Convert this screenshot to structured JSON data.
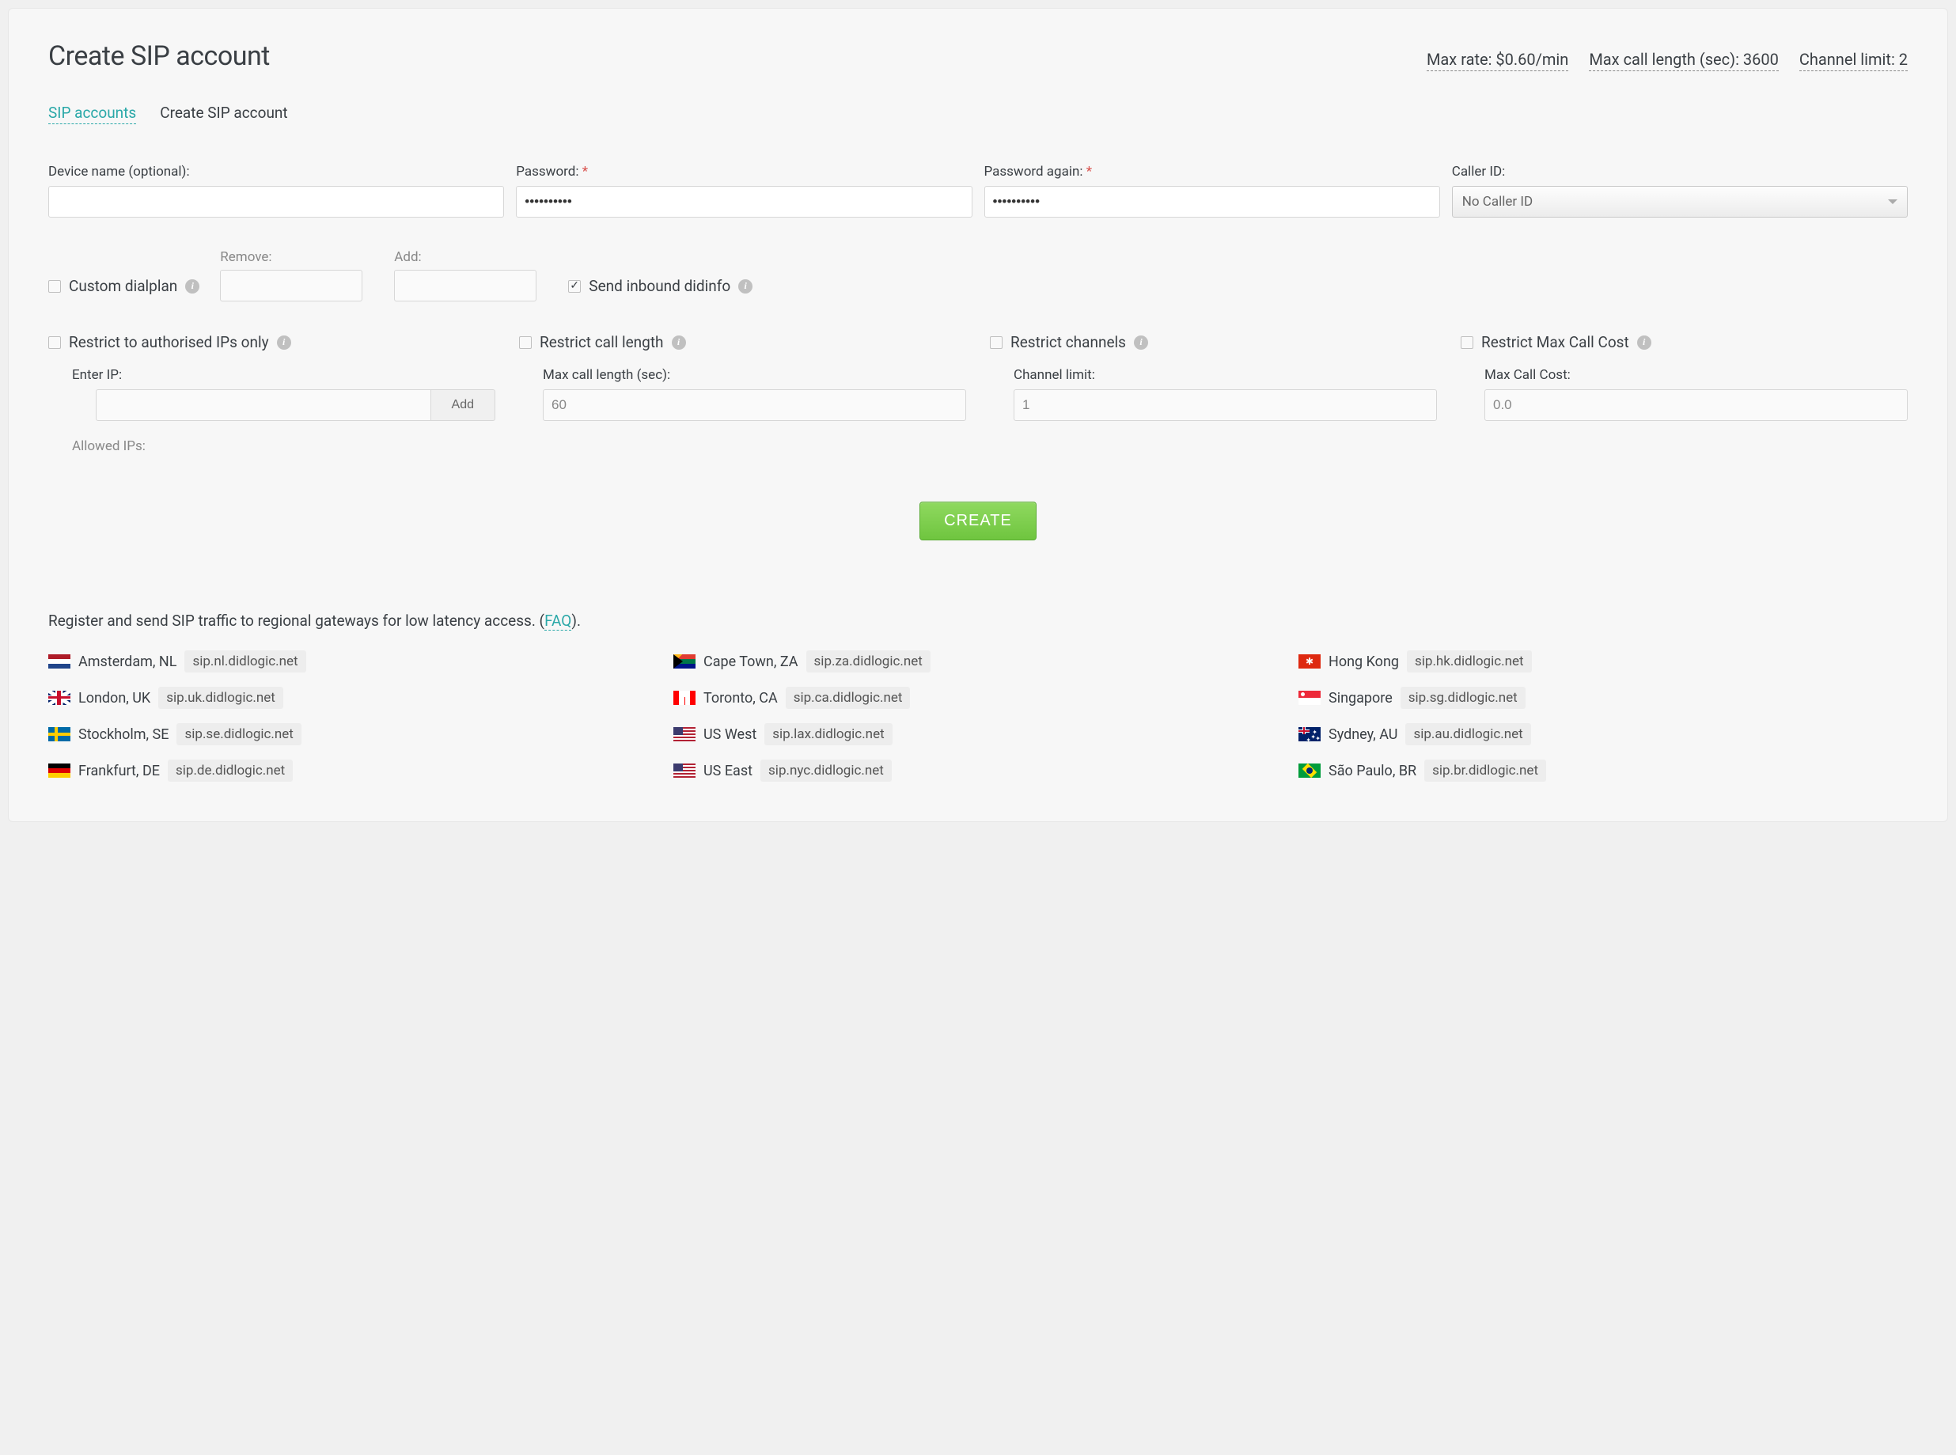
{
  "header": {
    "title": "Create SIP account",
    "max_rate": "Max rate: $0.60/min",
    "max_call_length": "Max call length (sec): 3600",
    "channel_limit": "Channel limit: 2"
  },
  "tabs": {
    "sip_accounts": "SIP accounts",
    "create": "Create SIP account"
  },
  "fields": {
    "device_name_label": "Device name (optional):",
    "password_label": "Password:",
    "password_again_label": "Password again:",
    "caller_id_label": "Caller ID:",
    "caller_id_value": "No Caller ID",
    "password_value": "••••••••••",
    "password_again_value": "••••••••••"
  },
  "dialplan": {
    "custom_label": "Custom dialplan",
    "remove_label": "Remove:",
    "add_label": "Add:",
    "didinfo_label": "Send inbound didinfo",
    "didinfo_checked": true
  },
  "restrict": {
    "ips": {
      "label": "Restrict to authorised IPs only",
      "enter_ip_label": "Enter IP:",
      "add_btn": "Add",
      "allowed_label": "Allowed IPs:"
    },
    "length": {
      "label": "Restrict call length",
      "sub": "Max call length (sec):",
      "value": "60"
    },
    "channels": {
      "label": "Restrict channels",
      "sub": "Channel limit:",
      "value": "1"
    },
    "cost": {
      "label": "Restrict Max Call Cost",
      "sub": "Max Call Cost:",
      "value": "0.0"
    }
  },
  "create_button": "CREATE",
  "gateways": {
    "intro_prefix": "Register and send SIP traffic to regional gateways for low latency access. (",
    "faq": "FAQ",
    "intro_suffix": ").",
    "list": [
      {
        "flag": "nl",
        "city": "Amsterdam, NL",
        "host": "sip.nl.didlogic.net"
      },
      {
        "flag": "za",
        "city": "Cape Town, ZA",
        "host": "sip.za.didlogic.net"
      },
      {
        "flag": "hk",
        "city": "Hong Kong",
        "host": "sip.hk.didlogic.net"
      },
      {
        "flag": "uk",
        "city": "London, UK",
        "host": "sip.uk.didlogic.net"
      },
      {
        "flag": "ca",
        "city": "Toronto, CA",
        "host": "sip.ca.didlogic.net"
      },
      {
        "flag": "sg",
        "city": "Singapore",
        "host": "sip.sg.didlogic.net"
      },
      {
        "flag": "se",
        "city": "Stockholm, SE",
        "host": "sip.se.didlogic.net"
      },
      {
        "flag": "us",
        "city": "US West",
        "host": "sip.lax.didlogic.net"
      },
      {
        "flag": "au",
        "city": "Sydney, AU",
        "host": "sip.au.didlogic.net"
      },
      {
        "flag": "de",
        "city": "Frankfurt, DE",
        "host": "sip.de.didlogic.net"
      },
      {
        "flag": "us",
        "city": "US East",
        "host": "sip.nyc.didlogic.net"
      },
      {
        "flag": "br",
        "city": "São Paulo, BR",
        "host": "sip.br.didlogic.net"
      }
    ]
  }
}
